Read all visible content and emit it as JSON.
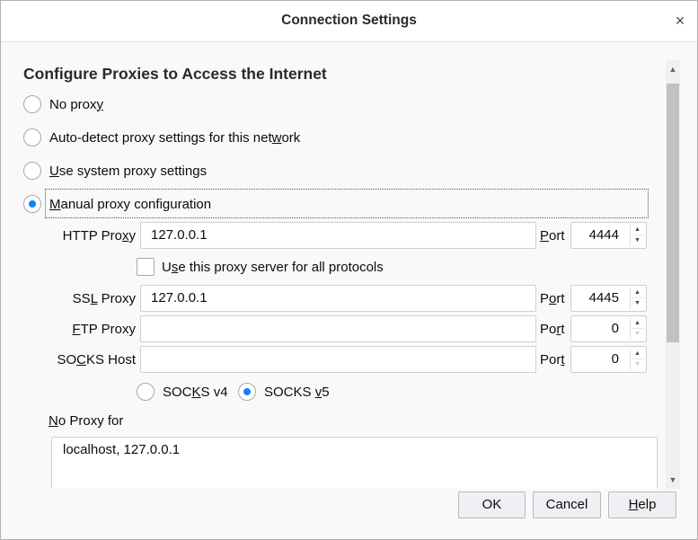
{
  "dialog": {
    "title": "Connection Settings",
    "close_glyph": "×"
  },
  "proxy": {
    "heading": "Configure Proxies to Access the Internet",
    "options": [
      {
        "pre": "No prox",
        "key": "y",
        "post": "",
        "checked": false
      },
      {
        "pre": "Auto-detect proxy settings for this net",
        "key": "w",
        "post": "ork",
        "checked": false
      },
      {
        "pre": "",
        "key": "U",
        "post": "se system proxy settings",
        "checked": false
      },
      {
        "pre": "",
        "key": "M",
        "post": "anual proxy configuration",
        "checked": true
      }
    ]
  },
  "manual": {
    "http": {
      "label_pre": "HTTP Pro",
      "label_key": "x",
      "label_post": "y",
      "value": "127.0.0.1",
      "port_pre": "",
      "port_key": "P",
      "port_post": "ort",
      "port": "4444"
    },
    "use_all": {
      "pre": "U",
      "key": "s",
      "post": "e this proxy server for all protocols",
      "checked": false
    },
    "ssl": {
      "label_pre": "SS",
      "label_key": "L",
      "label_post": " Proxy",
      "value": "127.0.0.1",
      "port_pre": "P",
      "port_key": "o",
      "port_post": "rt",
      "port": "4445"
    },
    "ftp": {
      "label_pre": "",
      "label_key": "F",
      "label_post": "TP Proxy",
      "value": "",
      "port_pre": "Po",
      "port_key": "r",
      "port_post": "t",
      "port": "0"
    },
    "socks": {
      "label_pre": "SO",
      "label_key": "C",
      "label_post": "KS Host",
      "value": "",
      "port_pre": "Por",
      "port_key": "t",
      "port_post": "",
      "port": "0"
    },
    "socks_v4": {
      "pre": "SOC",
      "key": "K",
      "post": "S v4",
      "checked": false
    },
    "socks_v5": {
      "pre": "SOCKS ",
      "key": "v",
      "post": "5",
      "checked": true
    }
  },
  "no_proxy": {
    "label_pre": "",
    "label_key": "N",
    "label_post": "o Proxy for",
    "value": "localhost, 127.0.0.1"
  },
  "scrollbar": {
    "up_glyph": "▲",
    "down_glyph": "▼"
  },
  "spinner": {
    "up_glyph": "▲",
    "down_glyph": "▼"
  },
  "buttons": {
    "ok": "OK",
    "cancel": "Cancel",
    "help_key": "H",
    "help_rest": "elp"
  },
  "colors": {
    "accent": "#0a84ff",
    "dialog_bg": "#f9f9fa"
  }
}
